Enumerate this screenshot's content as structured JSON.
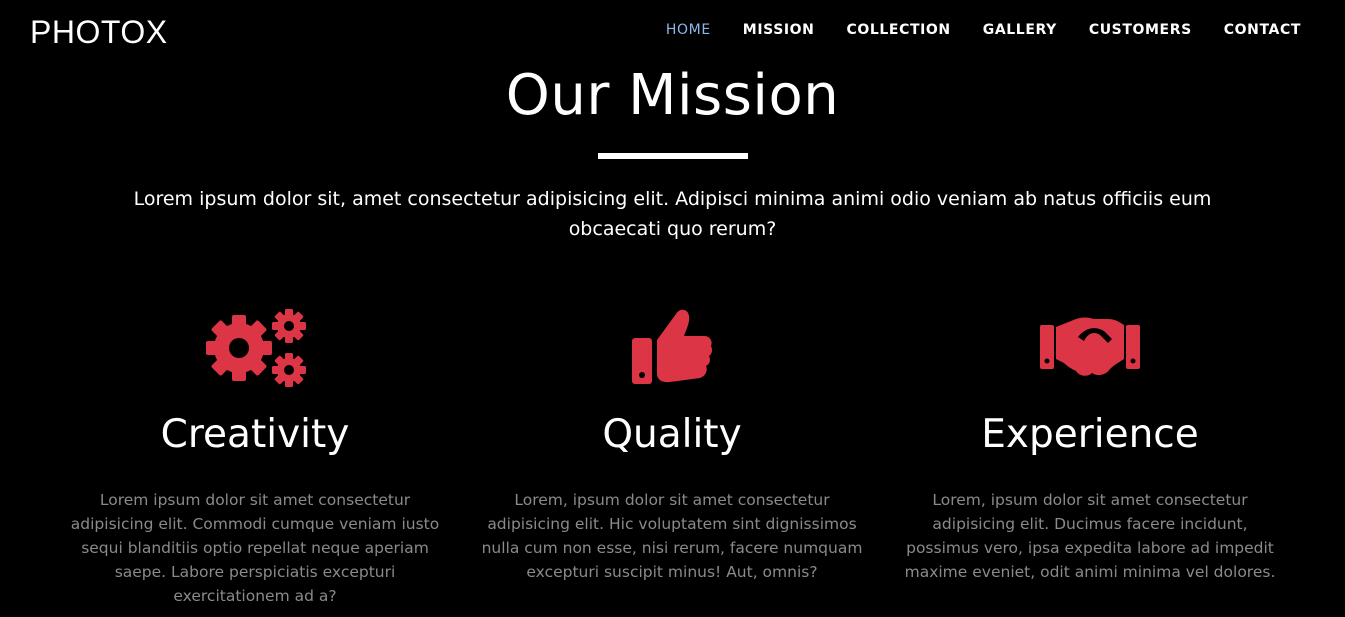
{
  "header": {
    "brand": "PHOTOX",
    "nav": [
      "HOME",
      "MISSION",
      "COLLECTION",
      "GALLERY",
      "CUSTOMERS",
      "CONTACT"
    ],
    "active_nav": "HOME"
  },
  "mission": {
    "title": "Our Mission",
    "lead": "Lorem ipsum dolor sit, amet consectetur adipisicing elit. Adipisci minima animi odio veniam ab natus officiis eum obcaecati quo rerum?"
  },
  "features": [
    {
      "icon": "cogs-icon",
      "title": "Creativity",
      "text": "Lorem ipsum dolor sit amet consectetur adipisicing elit. Commodi cumque veniam iusto sequi blanditiis optio repellat neque aperiam saepe. Labore perspiciatis excepturi exercitationem ad a?"
    },
    {
      "icon": "thumbs-up-icon",
      "title": "Quality",
      "text": "Lorem, ipsum dolor sit amet consectetur adipisicing elit. Hic voluptatem sint dignissimos nulla cum non esse, nisi rerum, facere numquam excepturi suscipit minus! Aut, omnis?"
    },
    {
      "icon": "handshake-icon",
      "title": "Experience",
      "text": "Lorem, ipsum dolor sit amet consectetur adipisicing elit. Ducimus facere incidunt, possimus vero, ipsa expedita labore ad impedit maxime eveniet, odit animi minima vel dolores."
    }
  ],
  "colors": {
    "background": "#000000",
    "accent": "#dc3545",
    "active_nav": "#8cb8e8",
    "muted_text": "#8a8a8a"
  }
}
